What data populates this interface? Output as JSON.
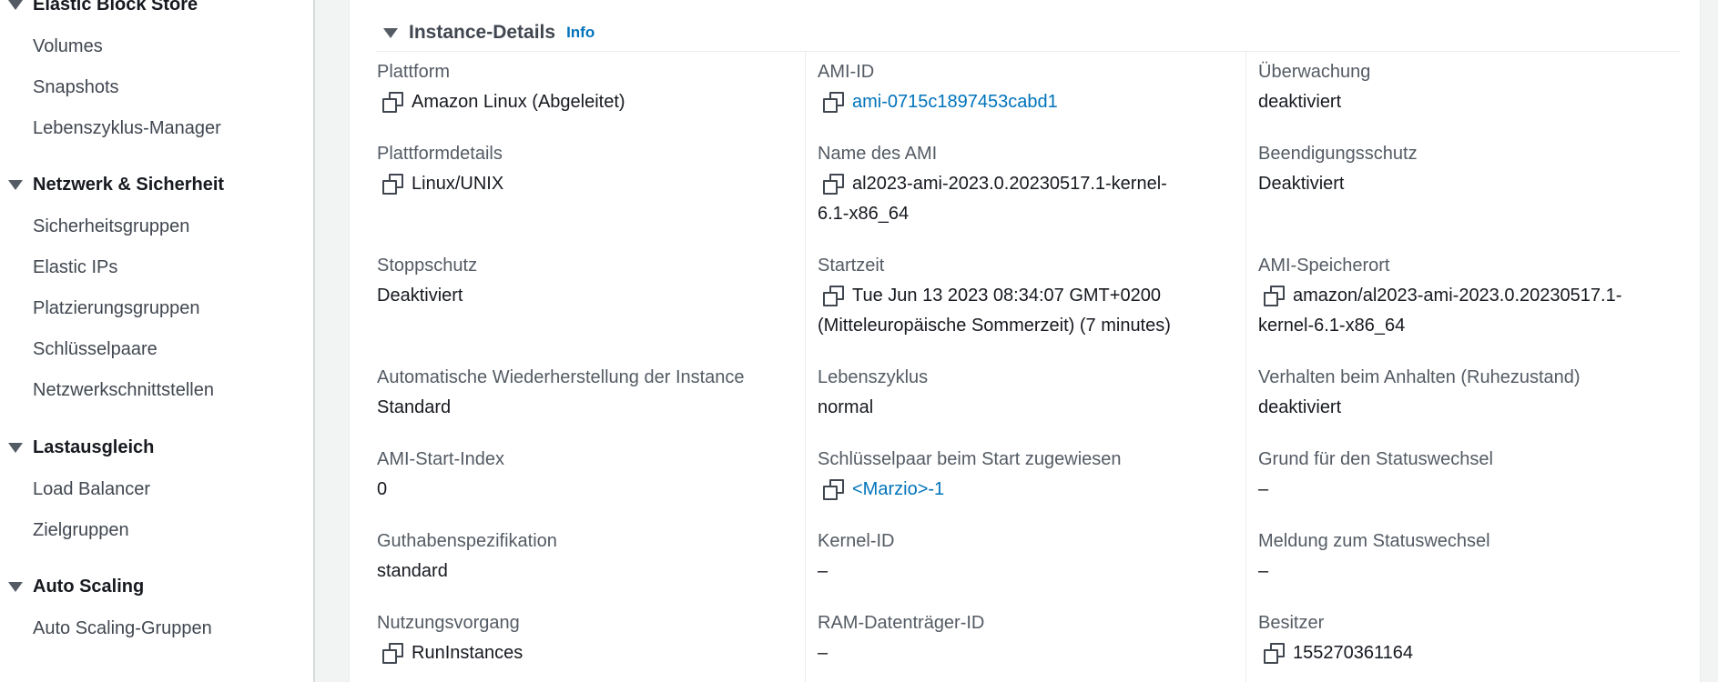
{
  "sidebar": {
    "sections": [
      {
        "title": "Elastic Block Store",
        "items": [
          "Volumes",
          "Snapshots",
          "Lebenszyklus-Manager"
        ]
      },
      {
        "title": "Netzwerk & Sicherheit",
        "items": [
          "Sicherheitsgruppen",
          "Elastic IPs",
          "Platzierungsgruppen",
          "Schlüsselpaare",
          "Netzwerkschnittstellen"
        ]
      },
      {
        "title": "Lastausgleich",
        "items": [
          "Load Balancer",
          "Zielgruppen"
        ]
      },
      {
        "title": "Auto Scaling",
        "items": [
          "Auto Scaling-Gruppen"
        ]
      }
    ]
  },
  "panel": {
    "title": "Instance-Details",
    "info_label": "Info"
  },
  "fields": {
    "plattform": {
      "label": "Plattform",
      "value": "Amazon Linux (Abgeleitet)"
    },
    "plattformdetails": {
      "label": "Plattformdetails",
      "value": "Linux/UNIX"
    },
    "stoppschutz": {
      "label": "Stoppschutz",
      "value": "Deaktiviert"
    },
    "auto_wiederherstellung": {
      "label": "Automatische Wiederherstellung der Instance",
      "value": "Standard"
    },
    "ami_start_index": {
      "label": "AMI-Start-Index",
      "value": "0"
    },
    "guthaben": {
      "label": "Guthabenspezifikation",
      "value": "standard"
    },
    "nutzungsvorgang": {
      "label": "Nutzungsvorgang",
      "value": "RunInstances"
    },
    "ami_id": {
      "label": "AMI-ID",
      "value": "ami-0715c1897453cabd1"
    },
    "ami_name": {
      "label": "Name des AMI",
      "value_line1": "al2023-ami-2023.0.20230517.1-kernel-",
      "value_line2": "6.1-x86_64"
    },
    "startzeit": {
      "label": "Startzeit",
      "value_line1": "Tue Jun 13 2023 08:34:07 GMT+0200",
      "value_line2": "(Mitteleuropäische Sommerzeit) (7 minutes)"
    },
    "lebenszyklus": {
      "label": "Lebenszyklus",
      "value": "normal"
    },
    "schluesselpaar": {
      "label": "Schlüsselpaar beim Start zugewiesen",
      "value": "<Marzio>-1"
    },
    "kernel_id": {
      "label": "Kernel-ID",
      "value": "–"
    },
    "ram_id": {
      "label": "RAM-Datenträger-ID",
      "value": "–"
    },
    "ueberwachung": {
      "label": "Überwachung",
      "value": "deaktiviert"
    },
    "beendigungsschutz": {
      "label": "Beendigungsschutz",
      "value": "Deaktiviert"
    },
    "ami_speicherort": {
      "label": "AMI-Speicherort",
      "value_line1": "amazon/al2023-ami-2023.0.20230517.1-",
      "value_line2": "kernel-6.1-x86_64"
    },
    "anhalten": {
      "label": "Verhalten beim Anhalten (Ruhezustand)",
      "value": "deaktiviert"
    },
    "grund_status": {
      "label": "Grund für den Statuswechsel",
      "value": "–"
    },
    "meldung_status": {
      "label": "Meldung zum Statuswechsel",
      "value": "–"
    },
    "besitzer": {
      "label": "Besitzer",
      "value": "155270361164"
    }
  },
  "colors": {
    "link": "#0073bb",
    "label": "#545b64",
    "text": "#16191f",
    "divider": "#eaeded"
  },
  "icons": {
    "copy": "copy-icon",
    "caret": "caret-down-icon"
  }
}
